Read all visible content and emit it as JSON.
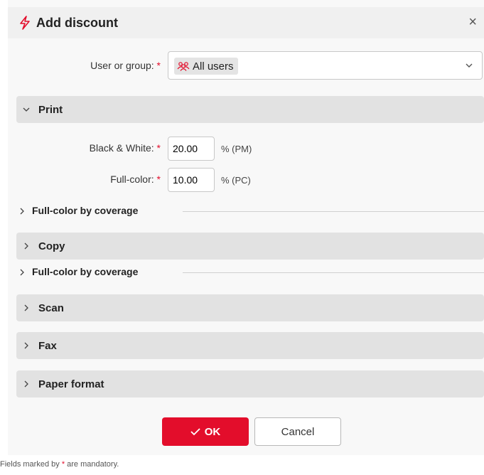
{
  "dialog": {
    "title": "Add discount",
    "close_symbol": "×"
  },
  "user_field": {
    "label": "User or group:",
    "required_mark": "*",
    "value": "All users"
  },
  "print_section": {
    "title": "Print",
    "bw": {
      "label": "Black & White:",
      "required_mark": "*",
      "value": "20.00",
      "unit": "% (PM)"
    },
    "color": {
      "label": "Full-color:",
      "required_mark": "*",
      "value": "10.00",
      "unit": "% (PC)"
    }
  },
  "subsection_1": {
    "title": "Full-color by coverage"
  },
  "copy_section": {
    "title": "Copy"
  },
  "subsection_2": {
    "title": "Full-color by coverage"
  },
  "scan_section": {
    "title": "Scan"
  },
  "fax_section": {
    "title": "Fax"
  },
  "paper_section": {
    "title": "Paper format"
  },
  "buttons": {
    "ok": "OK",
    "cancel": "Cancel"
  },
  "footer": {
    "before": "Fields marked by ",
    "mark": "*",
    "after": " are mandatory."
  },
  "colors": {
    "accent": "#e30d2b",
    "section_bg": "#e2e2e2",
    "header_bg": "#f0f0f0"
  }
}
